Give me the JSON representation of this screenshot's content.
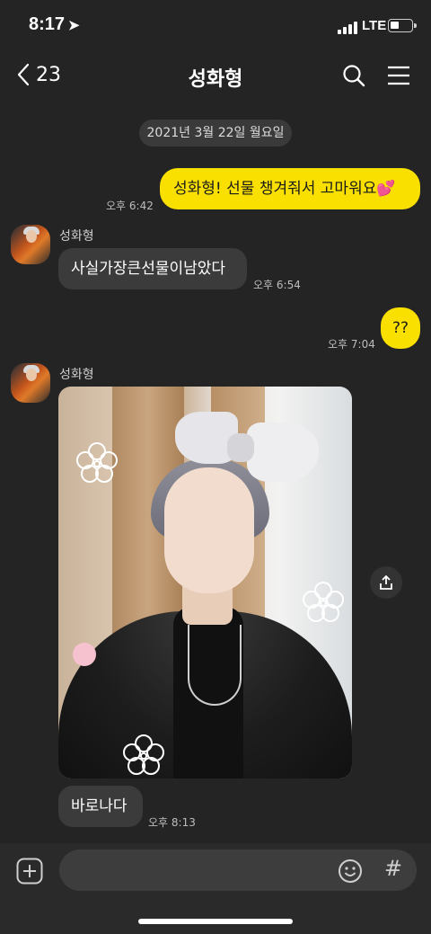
{
  "status_bar": {
    "time": "8:17",
    "network": "LTE"
  },
  "header": {
    "back_count": "23",
    "title": "성화형"
  },
  "date_divider": "2021년 3월 22일 월요일",
  "messages": [
    {
      "from": "me",
      "text": "성화형! 선물 챙겨줘서 고마워요💕",
      "time": "오후 6:42"
    },
    {
      "from": "other",
      "sender": "성화형",
      "text": "사실가장큰선물이남았다",
      "time": "오후 6:54"
    },
    {
      "from": "me",
      "text": "??",
      "time": "오후 7:04"
    },
    {
      "from": "other",
      "sender": "성화형",
      "type": "photo"
    },
    {
      "from": "other",
      "text": "바로나다",
      "time": "오후 8:13"
    }
  ],
  "input": {
    "value": "",
    "placeholder": ""
  },
  "colors": {
    "background": "#242424",
    "my_bubble": "#f9e000",
    "other_bubble": "#3b3b3b"
  }
}
